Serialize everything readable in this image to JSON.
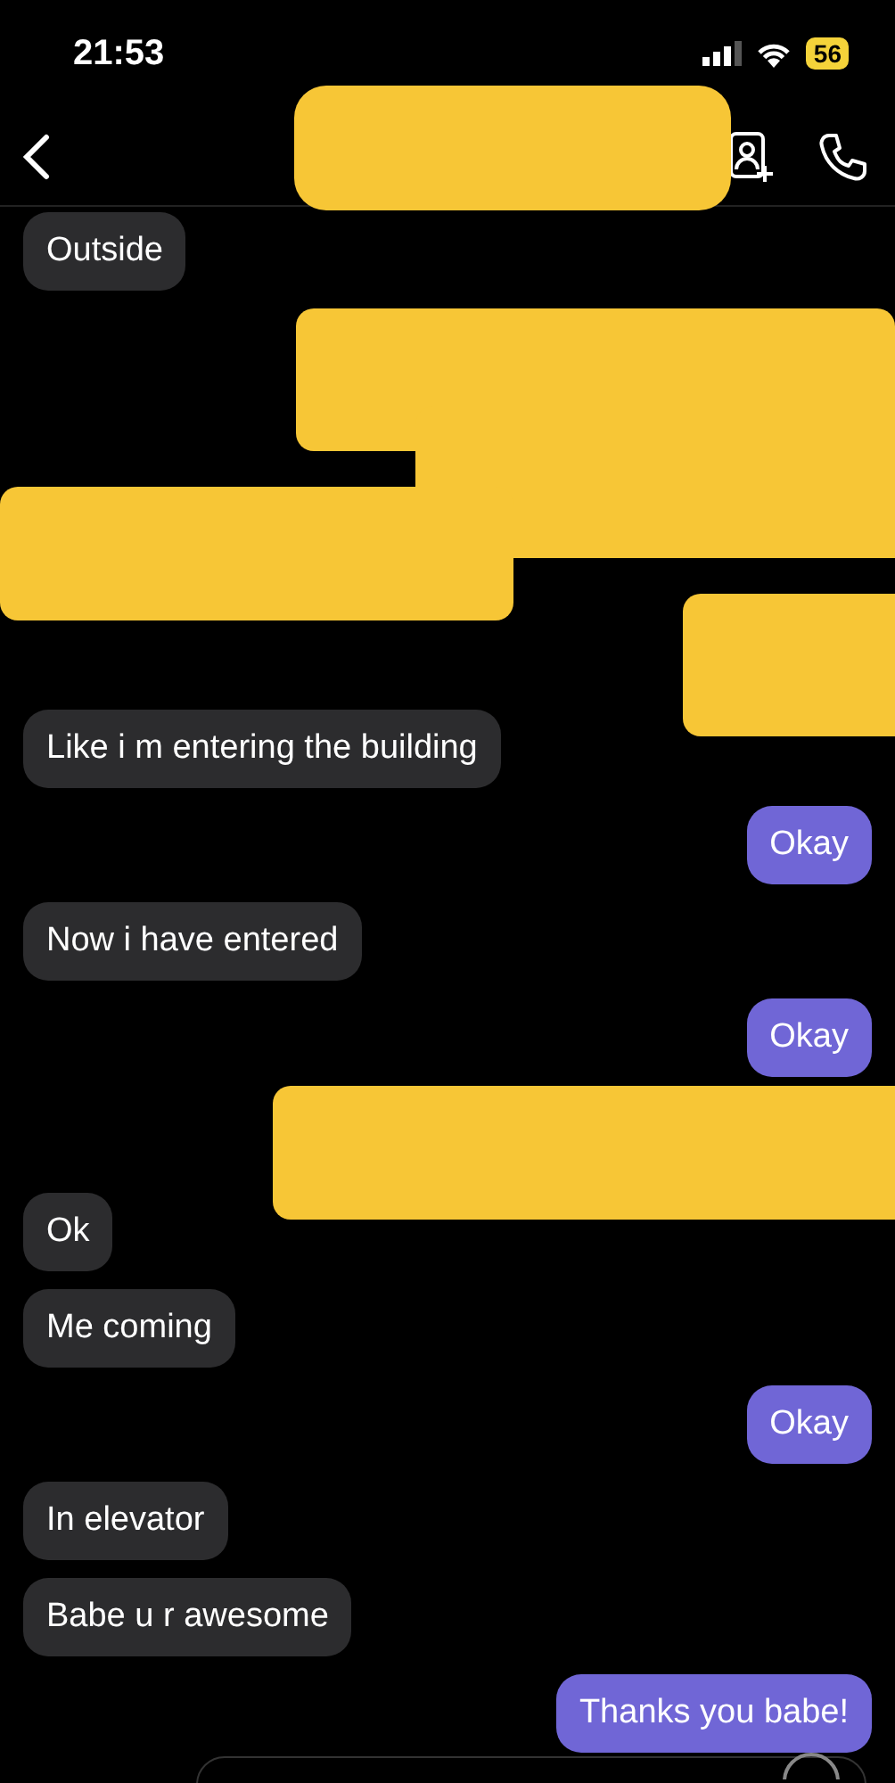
{
  "status_bar": {
    "time": "21:53",
    "battery": "56"
  },
  "header": {
    "contact_redacted": true
  },
  "messages": [
    {
      "kind": "incoming",
      "text": "Outside"
    },
    {
      "kind": "redacted"
    },
    {
      "kind": "incoming",
      "text": "Like i m entering the building"
    },
    {
      "kind": "outgoing",
      "text": "Okay"
    },
    {
      "kind": "incoming",
      "text": "Now i have entered"
    },
    {
      "kind": "outgoing",
      "text": "Okay"
    },
    {
      "kind": "redacted"
    },
    {
      "kind": "incoming",
      "text": "Ok"
    },
    {
      "kind": "incoming",
      "text": "Me coming"
    },
    {
      "kind": "outgoing",
      "text": "Okay"
    },
    {
      "kind": "incoming",
      "text": "In elevator"
    },
    {
      "kind": "incoming",
      "text": "Babe u r awesome"
    },
    {
      "kind": "outgoing",
      "text": "Thanks you babe!"
    }
  ]
}
